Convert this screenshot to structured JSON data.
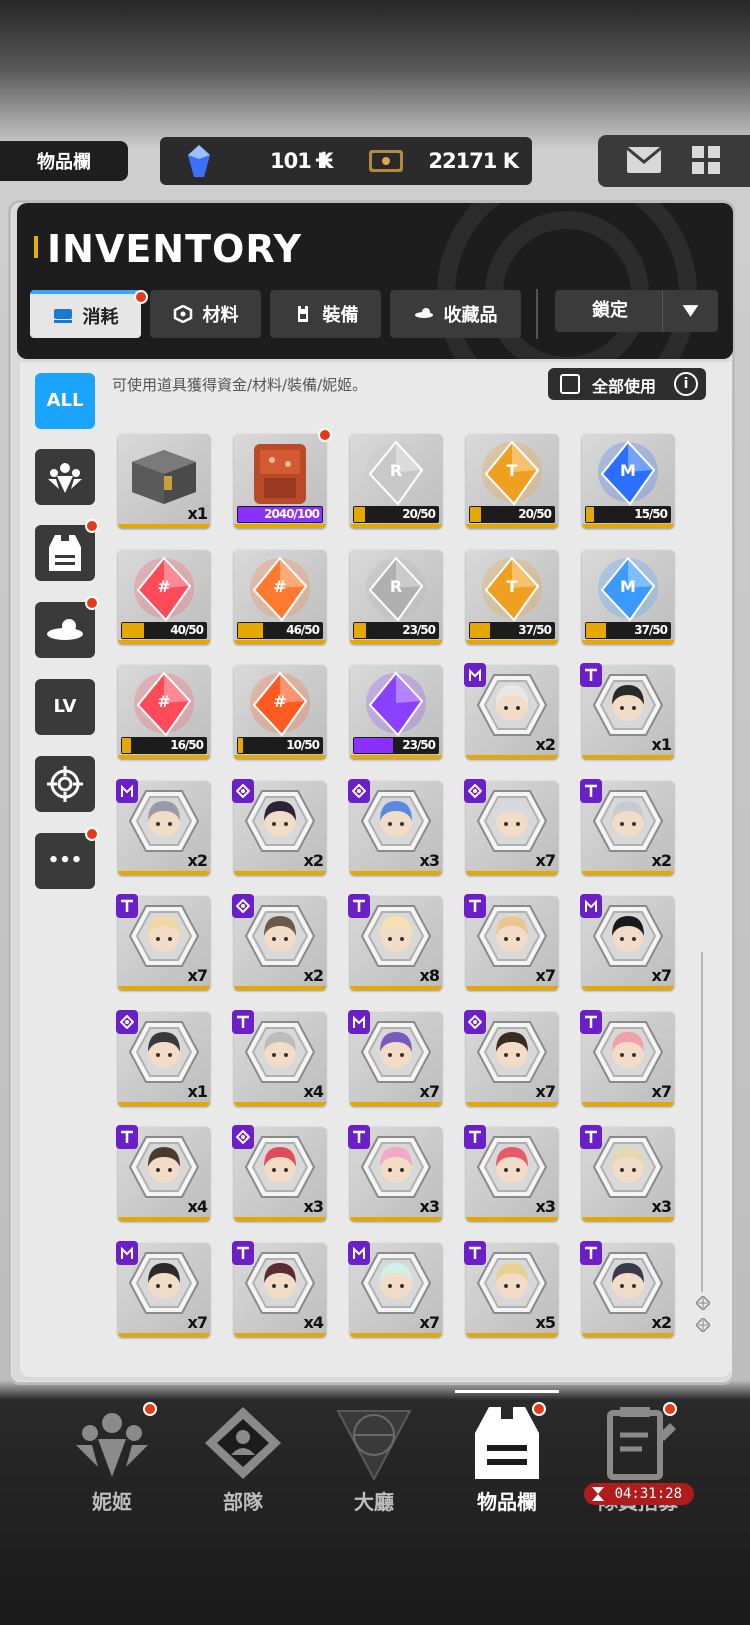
{
  "topbar": {
    "page_label": "物品欄",
    "gems": "101 K",
    "gems_plus": "+",
    "credits": "22171 K",
    "icons": [
      "gem-icon",
      "credit-card-icon",
      "mail-icon",
      "grid-menu-icon"
    ]
  },
  "header": {
    "title": "INVENTORY",
    "tabs": [
      {
        "label": "消耗",
        "icon": "consumable-icon",
        "active": true,
        "badge": true
      },
      {
        "label": "材料",
        "icon": "material-icon",
        "active": false
      },
      {
        "label": "裝備",
        "icon": "equipment-icon",
        "active": false
      },
      {
        "label": "收藏品",
        "icon": "collection-icon",
        "active": false
      }
    ],
    "lock_select": {
      "label": "鎖定"
    }
  },
  "content": {
    "description": "可使用道具獲得資金/材料/裝備/妮姬。",
    "use_all_label": "全部使用",
    "info_label": "i"
  },
  "side_filters": [
    {
      "label": "ALL",
      "icon": "all-icon",
      "active": true,
      "badge": false
    },
    {
      "label": "",
      "icon": "nikke-icon",
      "active": false,
      "badge": false
    },
    {
      "label": "",
      "icon": "equipment-vest-icon",
      "active": false,
      "badge": true
    },
    {
      "label": "",
      "icon": "collection-icon",
      "active": false,
      "badge": true
    },
    {
      "label": "LV",
      "icon": "level-up-icon",
      "active": false,
      "badge": false
    },
    {
      "label": "",
      "icon": "target-icon",
      "active": false,
      "badge": false
    },
    {
      "label": "•••",
      "icon": "more-icon",
      "active": false,
      "badge": true
    }
  ],
  "items": [
    {
      "kind": "chest",
      "icon": "supply-chest-icon",
      "qty": "x1"
    },
    {
      "kind": "backpack",
      "icon": "backpack-icon",
      "bar": "2040/100",
      "fill": 1.0,
      "purple": true,
      "badge": true
    },
    {
      "kind": "crystal",
      "color": "#c8c8c8",
      "letter": "R",
      "icon": "ssr-crystal-icon",
      "bar": "20/50",
      "fill": 0.4
    },
    {
      "kind": "crystal",
      "color": "#f0a020",
      "letter": "T",
      "icon": "ssr-crystal-icon",
      "bar": "20/50",
      "fill": 0.4
    },
    {
      "kind": "crystal",
      "color": "#2a6fff",
      "letter": "M",
      "icon": "ssr-crystal-icon",
      "bar": "15/50",
      "fill": 0.3
    },
    {
      "kind": "crystal",
      "color": "#ff4a5a",
      "letter": "#",
      "icon": "ssr-crystal-icon",
      "bar": "40/50",
      "fill": 0.8
    },
    {
      "kind": "crystal",
      "color": "#ff7a30",
      "letter": "#",
      "icon": "ssr-crystal-icon",
      "bar": "46/50",
      "fill": 0.92
    },
    {
      "kind": "crystal",
      "color": "#b0b0b0",
      "letter": "R",
      "icon": "crystal-icon",
      "bar": "23/50",
      "fill": 0.46
    },
    {
      "kind": "crystal",
      "color": "#f0a020",
      "letter": "T",
      "icon": "crystal-icon",
      "bar": "37/50",
      "fill": 0.74
    },
    {
      "kind": "crystal",
      "color": "#3a9aff",
      "letter": "M",
      "icon": "crystal-icon",
      "bar": "37/50",
      "fill": 0.74
    },
    {
      "kind": "crystal",
      "color": "#ff4a5a",
      "letter": "#",
      "icon": "crystal-icon",
      "bar": "16/50",
      "fill": 0.32
    },
    {
      "kind": "crystal",
      "color": "#ff5a20",
      "letter": "#",
      "icon": "crystal-icon",
      "bar": "10/50",
      "fill": 0.2
    },
    {
      "kind": "crystal",
      "color": "#8a40ff",
      "letter": "",
      "icon": "crystal-icon",
      "bar": "23/50",
      "fill": 0.46,
      "purple": true
    },
    {
      "kind": "char",
      "cls": "M",
      "qty": "x2",
      "hair": "#e8e8e8"
    },
    {
      "kind": "char",
      "cls": "T",
      "qty": "x1",
      "hair": "#2a2a2a"
    },
    {
      "kind": "char",
      "cls": "M",
      "qty": "x2",
      "hair": "#9a9aa8"
    },
    {
      "kind": "char",
      "cls": "D",
      "qty": "x2",
      "hair": "#2c2436"
    },
    {
      "kind": "char",
      "cls": "D",
      "qty": "x3",
      "hair": "#5a8ae0"
    },
    {
      "kind": "char",
      "cls": "D",
      "qty": "x7",
      "hair": "#d8d8e0"
    },
    {
      "kind": "char",
      "cls": "T",
      "qty": "x2",
      "hair": "#c8ccd0"
    },
    {
      "kind": "char",
      "cls": "T",
      "qty": "x7",
      "hair": "#f0d8a0"
    },
    {
      "kind": "char",
      "cls": "D",
      "qty": "x2",
      "hair": "#6a5a4a"
    },
    {
      "kind": "char",
      "cls": "T",
      "qty": "x8",
      "hair": "#f4e0b0"
    },
    {
      "kind": "char",
      "cls": "T",
      "qty": "x7",
      "hair": "#e8c890"
    },
    {
      "kind": "char",
      "cls": "M",
      "qty": "x7",
      "hair": "#1a1a1a"
    },
    {
      "kind": "char",
      "cls": "D",
      "qty": "x1",
      "hair": "#3a3a3a"
    },
    {
      "kind": "char",
      "cls": "T",
      "qty": "x4",
      "hair": "#bcbcbc"
    },
    {
      "kind": "char",
      "cls": "M",
      "qty": "x7",
      "hair": "#7a5ab8"
    },
    {
      "kind": "char",
      "cls": "D",
      "qty": "x7",
      "hair": "#3a2a20"
    },
    {
      "kind": "char",
      "cls": "T",
      "qty": "x7",
      "hair": "#f0a0a8"
    },
    {
      "kind": "char",
      "cls": "T",
      "qty": "x4",
      "hair": "#4a3a30"
    },
    {
      "kind": "char",
      "cls": "D",
      "qty": "x3",
      "hair": "#e04a5a"
    },
    {
      "kind": "char",
      "cls": "T",
      "qty": "x3",
      "hair": "#f4a8c8"
    },
    {
      "kind": "char",
      "cls": "T",
      "qty": "x3",
      "hair": "#e85a6a"
    },
    {
      "kind": "char",
      "cls": "T",
      "qty": "x3",
      "hair": "#e8d8b0"
    },
    {
      "kind": "char",
      "cls": "M",
      "qty": "x7",
      "hair": "#2a2a2a"
    },
    {
      "kind": "char",
      "cls": "T",
      "qty": "x4",
      "hair": "#5a2a30"
    },
    {
      "kind": "char",
      "cls": "M",
      "qty": "x7",
      "hair": "#d0f0e8"
    },
    {
      "kind": "char",
      "cls": "T",
      "qty": "x5",
      "hair": "#e8d090"
    },
    {
      "kind": "char",
      "cls": "T",
      "qty": "x2",
      "hair": "#3a3a4a"
    }
  ],
  "bottom_nav": [
    {
      "label": "妮姬",
      "icon": "nikke-icon",
      "badge": true,
      "active": false
    },
    {
      "label": "部隊",
      "icon": "squad-icon",
      "badge": false,
      "active": false
    },
    {
      "label": "大廳",
      "icon": "lobby-icon",
      "badge": false,
      "active": false
    },
    {
      "label": "物品欄",
      "icon": "inventory-icon",
      "badge": true,
      "active": true
    },
    {
      "label": "隊員招募",
      "icon": "recruit-icon",
      "badge": true,
      "active": false
    }
  ],
  "timer": "04:31:28",
  "colors": {
    "accent": "#1aa3ff",
    "gold": "#e4a800",
    "badge_purple": "#6a1fc9",
    "notify": "#e53a1a"
  }
}
